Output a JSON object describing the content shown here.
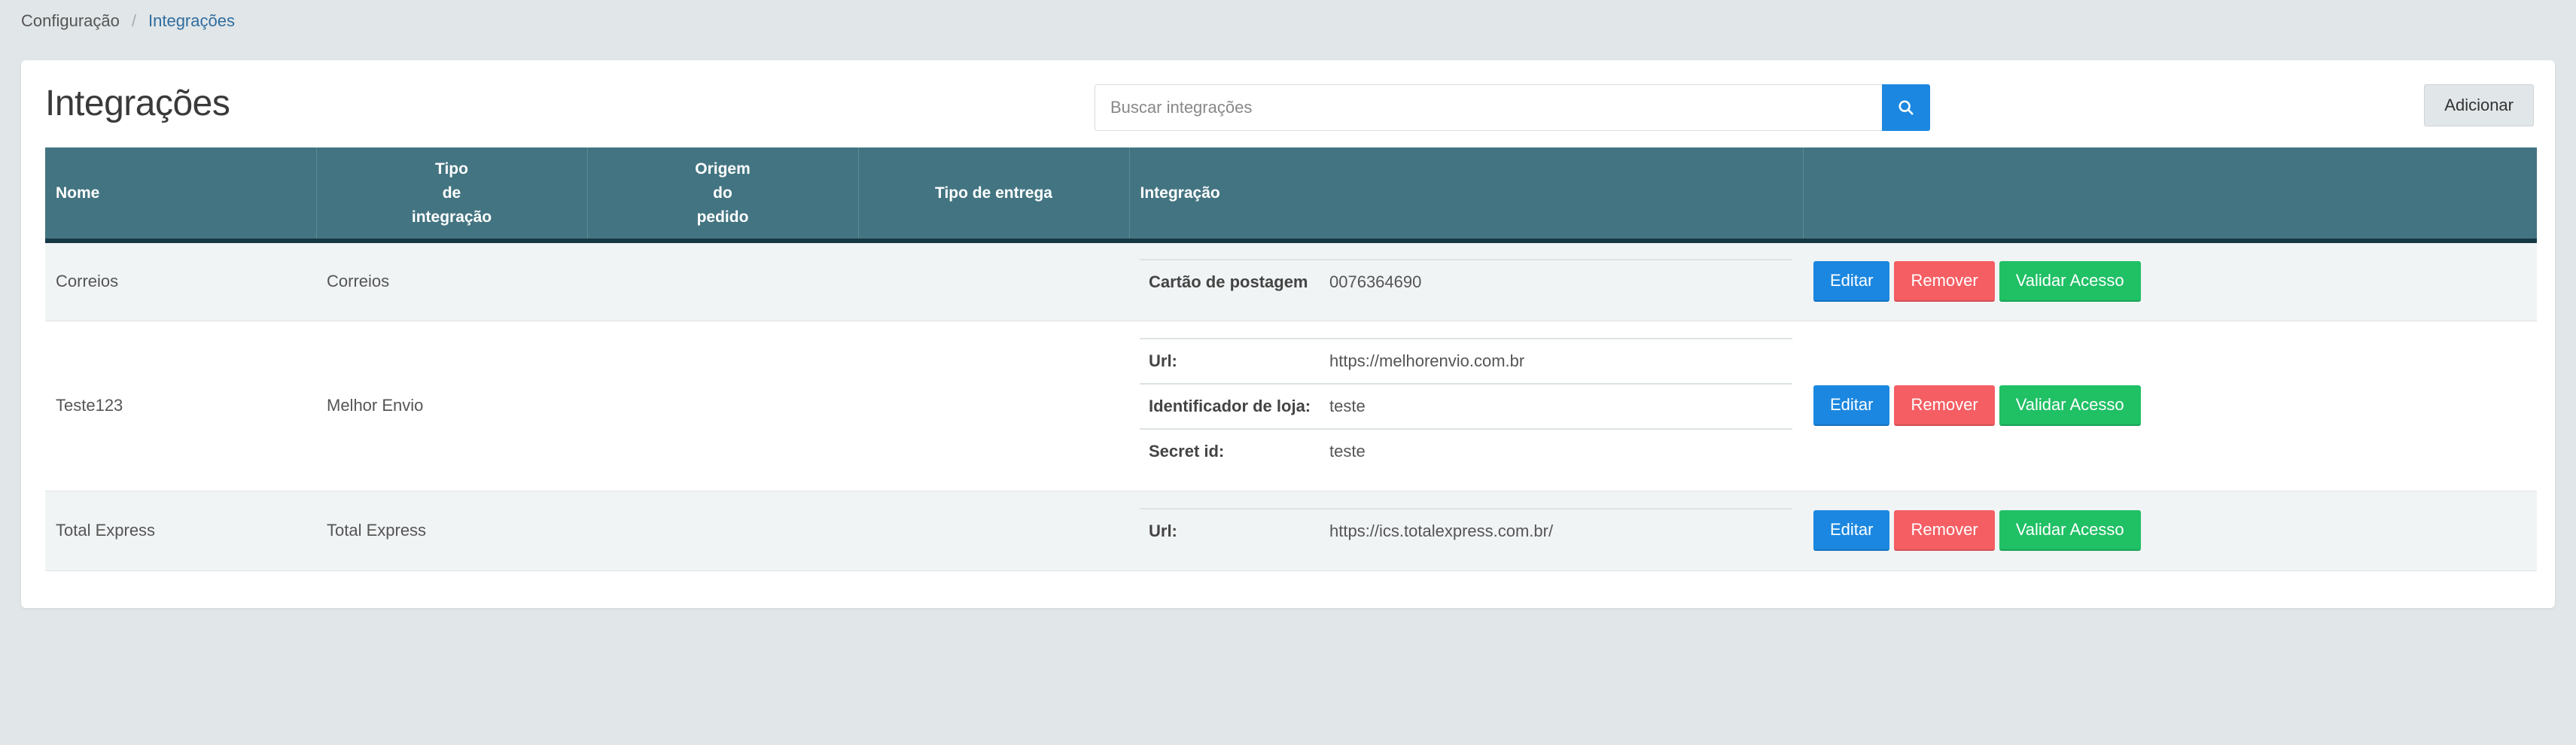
{
  "breadcrumb": {
    "parent": "Configuração",
    "separator": "/",
    "current": "Integrações"
  },
  "page": {
    "title": "Integrações"
  },
  "search": {
    "placeholder": "Buscar integrações",
    "value": ""
  },
  "toolbar": {
    "add_label": "Adicionar"
  },
  "table": {
    "headers": {
      "nome": "Nome",
      "tipo_line1": "Tipo",
      "tipo_line2": "de",
      "tipo_line3": "integração",
      "origem_line1": "Origem",
      "origem_line2": "do",
      "origem_line3": "pedido",
      "entrega": "Tipo de entrega",
      "integracao": "Integração"
    },
    "rows": [
      {
        "name": "Correios",
        "type": "Correios",
        "origin": "",
        "delivery": "",
        "fields": [
          {
            "key": "Cartão de postagem",
            "value": "0076364690"
          }
        ]
      },
      {
        "name": "Teste123",
        "type": "Melhor Envio",
        "origin": "",
        "delivery": "",
        "fields": [
          {
            "key": "Url:",
            "value": "https://melhorenvio.com.br"
          },
          {
            "key": "Identificador de loja:",
            "value": "teste"
          },
          {
            "key": "Secret id:",
            "value": "teste"
          }
        ]
      },
      {
        "name": "Total Express",
        "type": "Total Express",
        "origin": "",
        "delivery": "",
        "fields": [
          {
            "key": "Url:",
            "value": "https://ics.totalexpress.com.br/"
          }
        ]
      }
    ],
    "actions": {
      "edit": "Editar",
      "remove": "Remover",
      "validate": "Validar Acesso"
    }
  },
  "colors": {
    "header_bg": "#437481",
    "edit": "#1b87e0",
    "remove": "#f55e63",
    "validate": "#20c065"
  }
}
